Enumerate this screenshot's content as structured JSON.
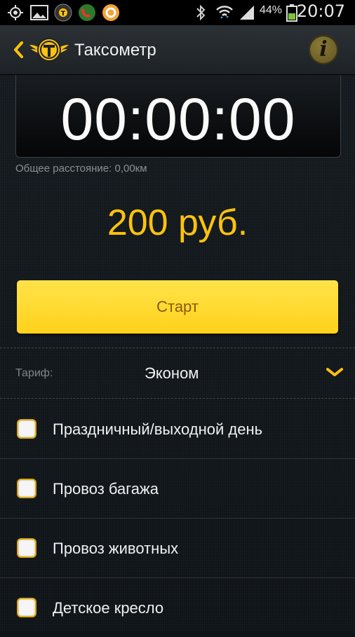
{
  "status_bar": {
    "battery_percent": "44%",
    "time": "20:07",
    "icons": [
      "gps-icon",
      "image-icon",
      "taxi-logo-icon",
      "call-icon",
      "app-icon",
      "bluetooth-icon",
      "wifi-icon",
      "signal-icon",
      "battery-icon"
    ]
  },
  "header": {
    "title": "Таксометр",
    "info_glyph": "i"
  },
  "timer": {
    "value": "00:00:00"
  },
  "distance": {
    "label": "Общее расстояние: 0,00км"
  },
  "price": {
    "value": "200 руб."
  },
  "start_button": {
    "label": "Старт"
  },
  "tariff": {
    "label": "Тариф:",
    "selected": "Эконом"
  },
  "options": [
    {
      "label": "Праздничный/выходной день",
      "checked": false
    },
    {
      "label": "Провоз багажа",
      "checked": false
    },
    {
      "label": "Провоз животных",
      "checked": false
    },
    {
      "label": "Детское кресло",
      "checked": false
    }
  ],
  "colors": {
    "accent_yellow": "#ffc20e",
    "button_yellow": "#ffd21a",
    "background": "#0f1418"
  }
}
